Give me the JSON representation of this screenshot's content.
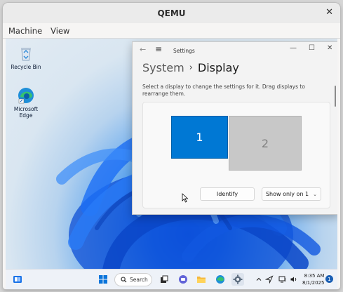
{
  "window": {
    "title": "QEMU",
    "close_glyph": "✕"
  },
  "menubar": {
    "items": [
      "Machine",
      "View"
    ]
  },
  "desktop": {
    "icons": [
      {
        "label": "Recycle Bin",
        "icon": "recycle-bin-icon"
      },
      {
        "label": "Microsoft Edge",
        "icon": "edge-icon"
      }
    ]
  },
  "settings": {
    "app_title": "Settings",
    "back_glyph": "←",
    "menu_glyph": "≡",
    "minimize_glyph": "—",
    "maximize_glyph": "☐",
    "close_glyph": "✕",
    "breadcrumb_parent": "System",
    "breadcrumb_sep": "›",
    "breadcrumb_current": "Display",
    "description": "Select a display to change the settings for it. Drag displays to rearrange them.",
    "monitors": [
      {
        "label": "1",
        "selected": true
      },
      {
        "label": "2",
        "selected": false
      }
    ],
    "identify_label": "Identify",
    "show_only_label": "Show only on 1",
    "show_only_chevron": "⌄"
  },
  "taskbar": {
    "search_label": "Search",
    "time": "8:35 AM",
    "date": "8/1/2025",
    "notification_count": "1",
    "accent": "#0078d4",
    "icons": [
      "widgets-icon",
      "start-icon",
      "search-icon",
      "task-view-icon",
      "teams-chat-icon",
      "file-explorer-icon",
      "edge-icon",
      "settings-icon",
      "chevron-up-icon",
      "network-icon",
      "display-icon",
      "volume-icon"
    ]
  },
  "colors": {
    "selected_monitor": "#0078d4",
    "unselected_monitor": "#c8c8c8"
  }
}
